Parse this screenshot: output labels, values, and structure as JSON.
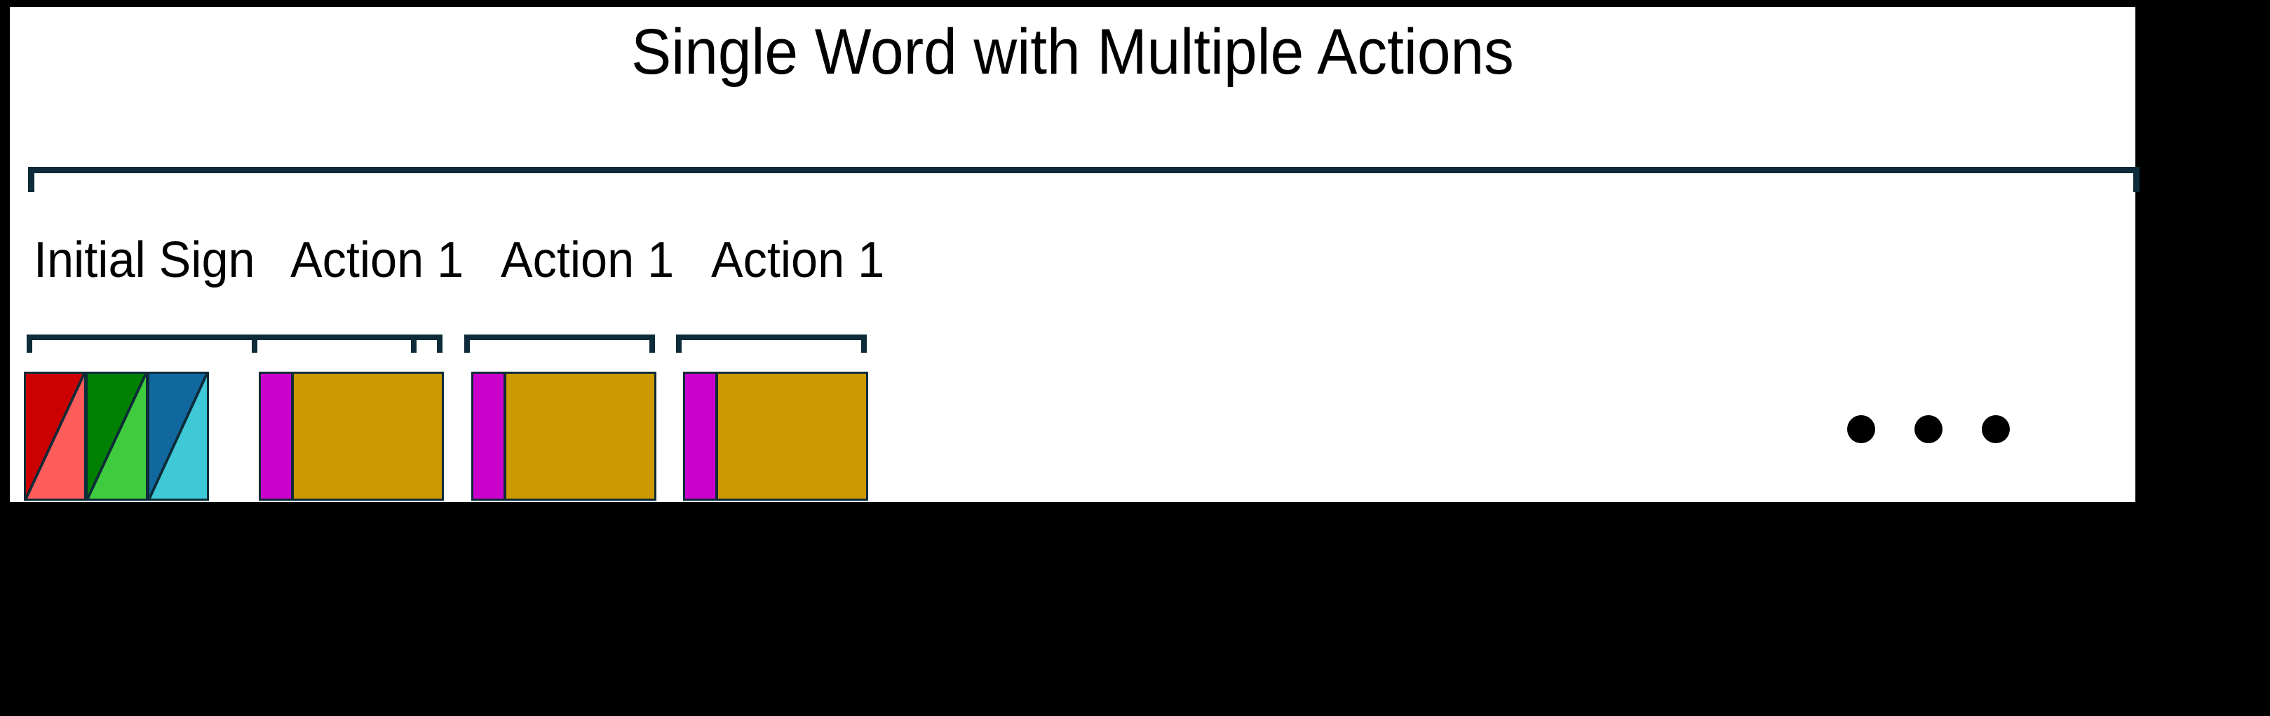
{
  "figure": {
    "title": "Single Word with Multiple Actions",
    "background_color": "#000000",
    "panel_color": "#ffffff",
    "bracket_color": "#0D2B38"
  },
  "top_bracket": {
    "name": "word-span-bracket",
    "spans_label": "Single Word with Multiple Actions"
  },
  "groups": [
    {
      "label": "Initial Sign",
      "kind": "initial-sign",
      "cells": [
        {
          "name": "sign-cell-red",
          "upper_color": "#CC0000",
          "lower_color": "#FF5C5C"
        },
        {
          "name": "sign-cell-green",
          "upper_color": "#008000",
          "lower_color": "#3ECC3E"
        },
        {
          "name": "sign-cell-blue",
          "upper_color": "#10689E",
          "lower_color": "#3FC8D6"
        }
      ]
    },
    {
      "label": "Action 1",
      "kind": "action",
      "stub_color": "#CC00CC",
      "body_color": "#CC9900"
    },
    {
      "label": "Action 1",
      "kind": "action",
      "stub_color": "#CC00CC",
      "body_color": "#CC9900"
    },
    {
      "label": "Action 1",
      "kind": "action",
      "stub_color": "#CC00CC",
      "body_color": "#CC9900"
    }
  ],
  "continuation": {
    "name": "ellipsis",
    "symbol": "dots",
    "count": 3,
    "color": "#000000"
  }
}
